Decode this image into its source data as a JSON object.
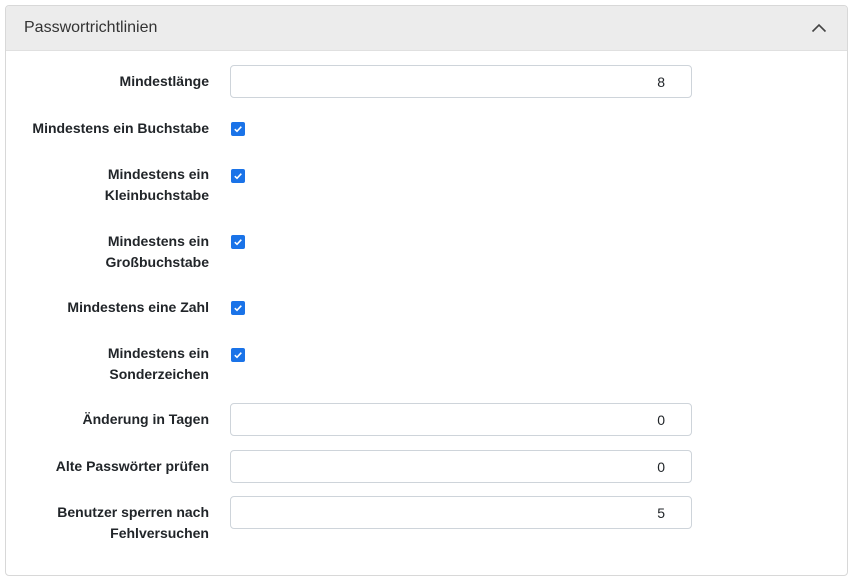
{
  "panel": {
    "title": "Passwortrichtlinien",
    "collapse_icon": "chevron-up-icon"
  },
  "fields": {
    "min_length": {
      "label": "Mindestlänge",
      "value": "8"
    },
    "min_letter": {
      "label": "Mindestens ein Buchstabe",
      "checked": true
    },
    "min_lower": {
      "label_line1": "Mindestens ein",
      "label_line2": "Kleinbuchstabe",
      "checked": true
    },
    "min_upper": {
      "label_line1": "Mindestens ein",
      "label_line2": "Großbuchstabe",
      "checked": true
    },
    "min_number": {
      "label": "Mindestens eine Zahl",
      "checked": true
    },
    "min_special": {
      "label_line1": "Mindestens ein",
      "label_line2": "Sonderzeichen",
      "checked": true
    },
    "change_days": {
      "label": "Änderung in Tagen",
      "value": "0"
    },
    "check_old": {
      "label": "Alte Passwörter prüfen",
      "value": "0"
    },
    "lockout": {
      "label_line1": "Benutzer sperren nach",
      "label_line2": "Fehlversuchen",
      "value": "5"
    }
  },
  "colors": {
    "accent": "#1a73e8",
    "header_bg": "#ececec"
  }
}
